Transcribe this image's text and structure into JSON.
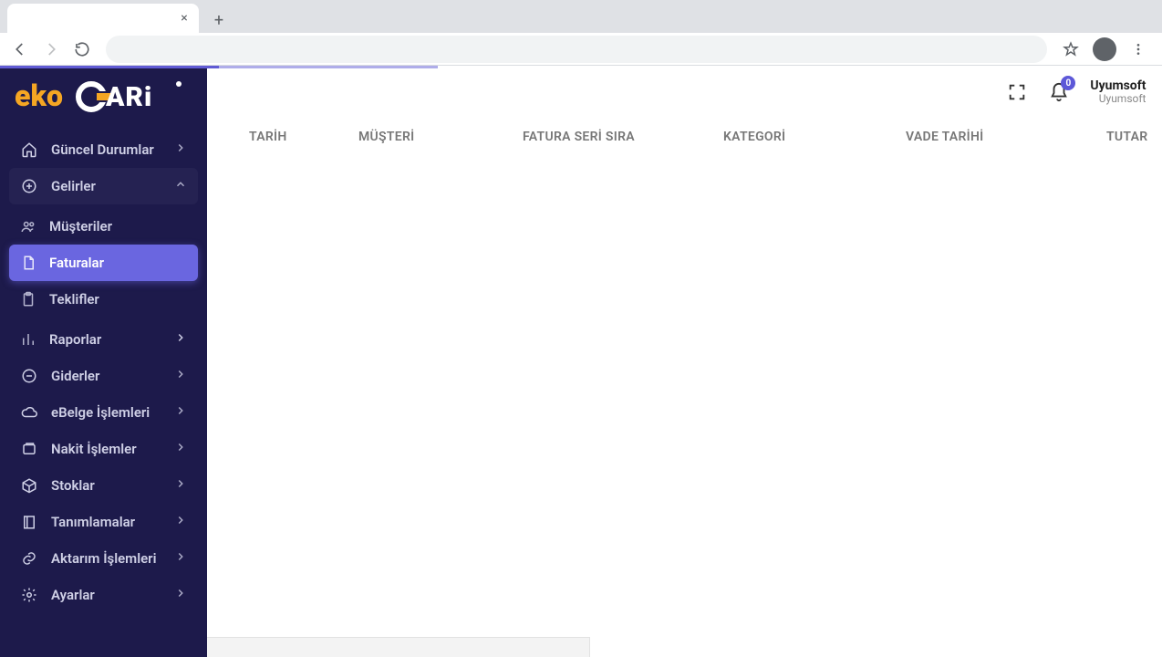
{
  "browser": {
    "tab_title": "",
    "close_glyph": "×",
    "newtab_glyph": "+"
  },
  "logo": {
    "text_eko": "eko",
    "text_cari": "CARi",
    "accent1": "#f5a623",
    "accent2": "#ffffff"
  },
  "sidebar": {
    "items": [
      {
        "id": "guncel",
        "icon": "home",
        "label": "Güncel Durumlar",
        "expandable": true,
        "expanded": false
      },
      {
        "id": "gelirler",
        "icon": "plus-o",
        "label": "Gelirler",
        "expandable": true,
        "expanded": true,
        "children": [
          {
            "id": "musteriler",
            "icon": "users",
            "label": "Müşteriler",
            "active": false
          },
          {
            "id": "faturalar",
            "icon": "doc",
            "label": "Faturalar",
            "active": true
          },
          {
            "id": "teklifler",
            "icon": "clip",
            "label": "Teklifler",
            "active": false
          }
        ]
      },
      {
        "id": "raporlar",
        "icon": "chart",
        "label": "Raporlar",
        "expandable": true,
        "indent": true
      },
      {
        "id": "giderler",
        "icon": "minus-o",
        "label": "Giderler",
        "expandable": true
      },
      {
        "id": "ebelge",
        "icon": "cloud",
        "label": "eBelge İşlemleri",
        "expandable": true
      },
      {
        "id": "nakit",
        "icon": "wallet",
        "label": "Nakit İşlemler",
        "expandable": true
      },
      {
        "id": "stoklar",
        "icon": "box",
        "label": "Stoklar",
        "expandable": true
      },
      {
        "id": "tanim",
        "icon": "book",
        "label": "Tanımlamalar",
        "expandable": true
      },
      {
        "id": "aktarim",
        "icon": "link",
        "label": "Aktarım İşlemleri",
        "expandable": true
      },
      {
        "id": "ayarlar",
        "icon": "gear",
        "label": "Ayarlar",
        "expandable": true
      }
    ]
  },
  "header": {
    "notifications_count": "0",
    "user_name": "Uyumsoft",
    "user_sub": "Uyumsoft"
  },
  "table": {
    "columns": [
      "TARİH",
      "MÜŞTERİ",
      "FATURA SERİ SIRA",
      "KATEGORİ",
      "VADE TARİHİ",
      "TUTAR"
    ],
    "rows": []
  }
}
